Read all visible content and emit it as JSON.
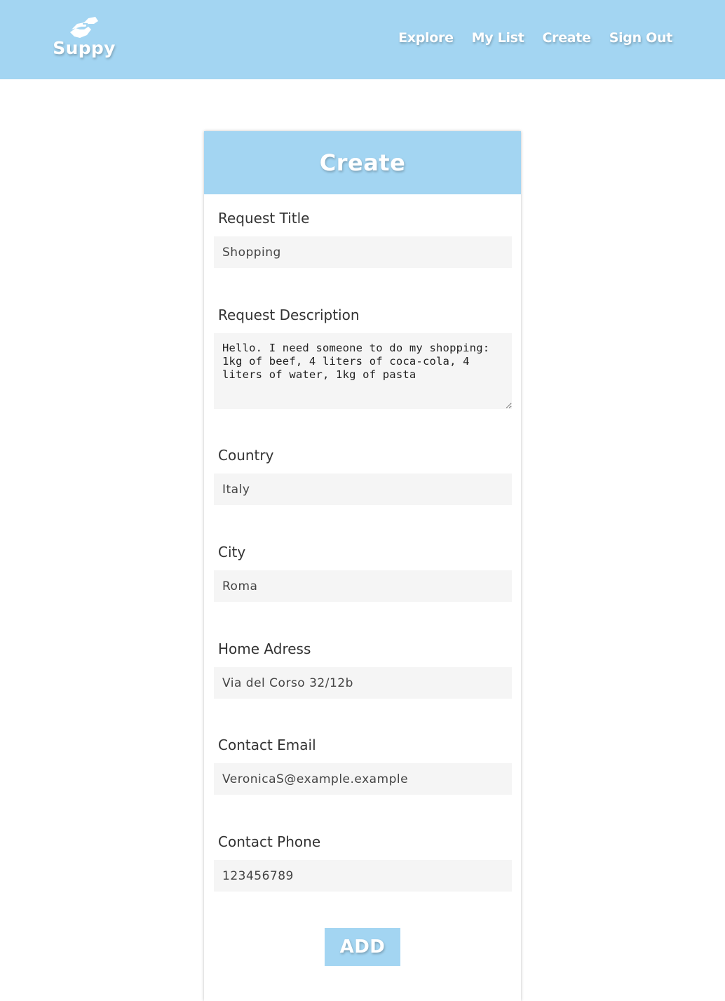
{
  "header": {
    "logo_text": "Suppy",
    "logo_icon": "handshake-icon",
    "nav": [
      {
        "label": "Explore"
      },
      {
        "label": "My List"
      },
      {
        "label": "Create"
      },
      {
        "label": "Sign Out"
      }
    ]
  },
  "form": {
    "title": "Create",
    "fields": {
      "request_title": {
        "label": "Request Title",
        "value": "Shopping"
      },
      "request_description": {
        "label": "Request Description",
        "value": "Hello. I need someone to do my shopping: 1kg of beef, 4 liters of coca-cola, 4 liters of water, 1kg of pasta"
      },
      "country": {
        "label": "Country",
        "value": "Italy"
      },
      "city": {
        "label": "City",
        "value": "Roma"
      },
      "home_address": {
        "label": "Home Adress",
        "value": "Via del Corso 32/12b"
      },
      "contact_email": {
        "label": "Contact Email",
        "value": "VeronicaS@example.example"
      },
      "contact_phone": {
        "label": "Contact Phone",
        "value": "123456789"
      }
    },
    "submit_label": "ADD"
  },
  "colors": {
    "brand": "#a3d5f2",
    "input_bg": "#f5f5f5",
    "text": "#333333"
  }
}
